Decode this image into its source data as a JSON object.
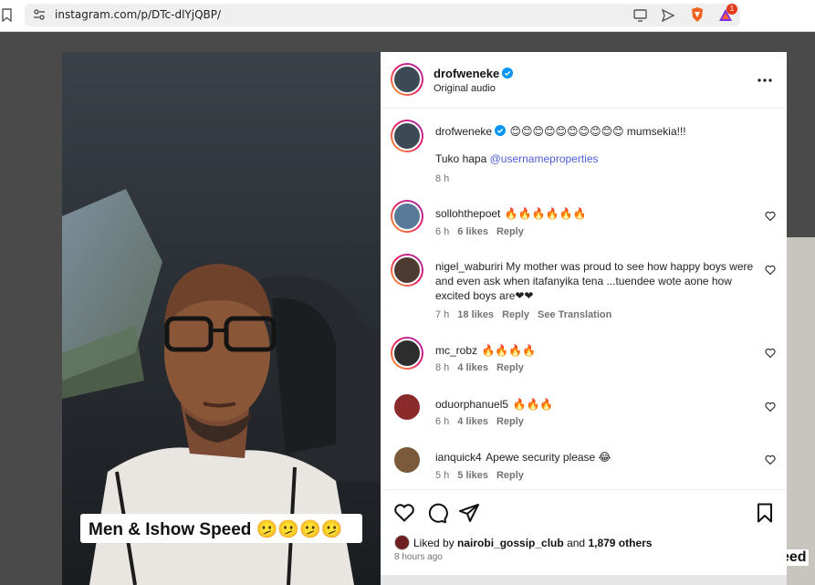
{
  "browser": {
    "url": "instagram.com/p/DTc-dlYjQBP/",
    "brave_badge_count": "1"
  },
  "media": {
    "caption": "Men & Ishow Speed 🫤🫤🫤🫤",
    "peek_text": "eed"
  },
  "post": {
    "author": "drofweneke",
    "audio": "Original audio",
    "caption_text": "😊😊😊😊😊😊😊😊😊😊 mumsekia!!!",
    "caption_line2_prefix": "Tuko hapa ",
    "caption_mention": "@usernameproperties",
    "caption_time": "8 h"
  },
  "comments": [
    {
      "user": "sollohthepoet",
      "text": "🔥🔥🔥🔥🔥🔥",
      "time": "6 h",
      "likes": "6 likes",
      "reply": "Reply",
      "translate": ""
    },
    {
      "user": "nigel_waburiri",
      "text": "My mother was proud to see how happy boys were and even ask when itafanyika tena ...tuendee wote aone how excited boys are❤❤",
      "time": "7 h",
      "likes": "18 likes",
      "reply": "Reply",
      "translate": "See Translation"
    },
    {
      "user": "mc_robz",
      "text": "🔥🔥🔥🔥",
      "time": "8 h",
      "likes": "4 likes",
      "reply": "Reply",
      "translate": ""
    },
    {
      "user": "oduorphanuel5",
      "text": "🔥🔥🔥",
      "time": "6 h",
      "likes": "4 likes",
      "reply": "Reply",
      "translate": ""
    },
    {
      "user": "ianquick4",
      "text": "Apewe security please 😂",
      "time": "5 h",
      "likes": "5 likes",
      "reply": "Reply",
      "translate": ""
    }
  ],
  "actions": {
    "liked_by_prefix": "Liked by ",
    "liked_by_user": "nairobi_gossip_club",
    "liked_by_and": " and ",
    "liked_by_others": "1,879 others",
    "posted_ago": "8 hours ago"
  },
  "colors": {
    "accent": "#0095f6",
    "mention": "#4c5fd7",
    "meta": "#737373"
  }
}
